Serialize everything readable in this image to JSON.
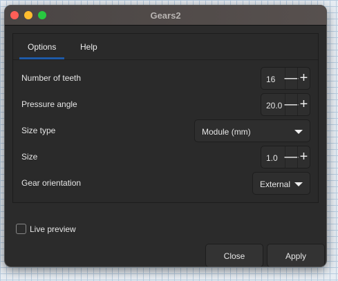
{
  "window": {
    "title": "Gears2"
  },
  "tabs": [
    {
      "label": "Options"
    },
    {
      "label": "Help"
    }
  ],
  "fields": {
    "teeth": {
      "label": "Number of teeth",
      "value": "16"
    },
    "pressure": {
      "label": "Pressure angle",
      "value": "20.0"
    },
    "size_type": {
      "label": "Size type",
      "value": "Module (mm)"
    },
    "size": {
      "label": "Size",
      "value": "1.0"
    },
    "orientation": {
      "label": "Gear orientation",
      "value": "External"
    }
  },
  "live_preview": {
    "label": "Live preview",
    "checked": false
  },
  "buttons": {
    "close": "Close",
    "apply": "Apply"
  },
  "stepper": {
    "minus": "—",
    "plus": "+"
  }
}
